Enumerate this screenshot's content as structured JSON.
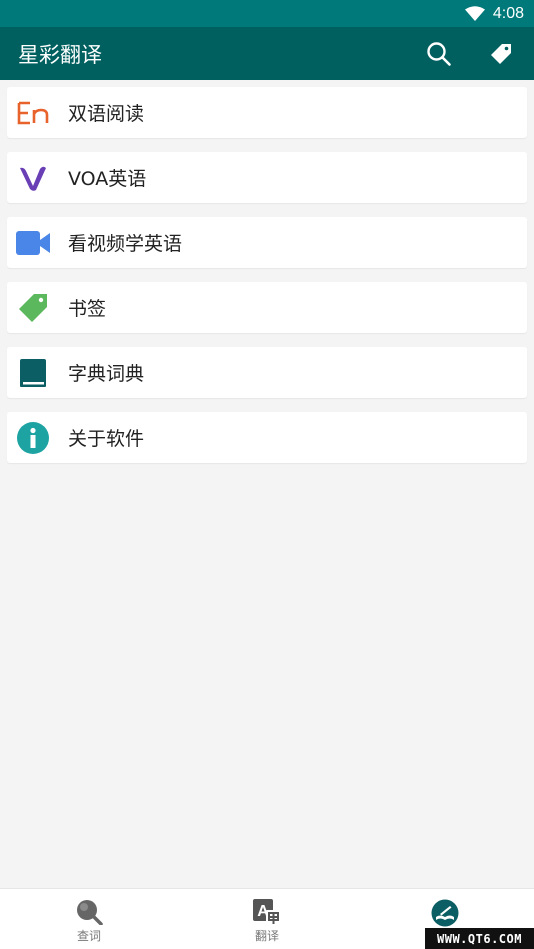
{
  "status_bar": {
    "time": "4:08"
  },
  "app_bar": {
    "title": "星彩翻译"
  },
  "menu": [
    {
      "label": "双语阅读",
      "icon": "en-letters-icon"
    },
    {
      "label": "VOA英语",
      "icon": "voa-v-icon"
    },
    {
      "label": "看视频学英语",
      "icon": "video-camera-icon"
    },
    {
      "label": "书签",
      "icon": "bookmark-tag-icon"
    },
    {
      "label": "字典词典",
      "icon": "dictionary-book-icon"
    },
    {
      "label": "关于软件",
      "icon": "info-icon"
    }
  ],
  "bottom_nav": [
    {
      "label": "查词",
      "icon": "magnifier-icon"
    },
    {
      "label": "翻译",
      "icon": "translate-icon"
    },
    {
      "label": "",
      "icon": "reading-book-icon",
      "active": true
    }
  ],
  "watermark": "WWW.QT6.COM",
  "colors": {
    "status_bar": "#00797a",
    "app_bar": "#00605f",
    "background": "#f4f4f4",
    "en_icon": "#e8632c",
    "voa_icon": "#6a3fb5",
    "video_icon": "#4a86e8",
    "bookmark_icon": "#5cb85c",
    "book_icon": "#0b5e63",
    "info_icon": "#1ea3a3"
  }
}
